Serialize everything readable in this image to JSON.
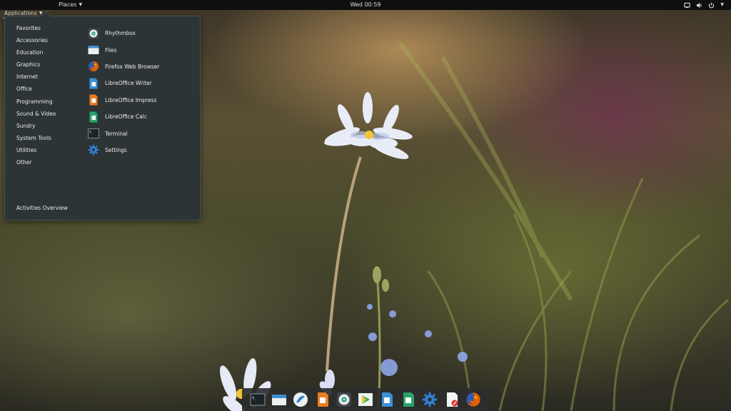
{
  "topbar": {
    "applications_label": "Applications",
    "places_label": "Places",
    "clock": "Wed 00:59",
    "tray_icons": [
      "screen-icon",
      "volume-icon",
      "power-icon"
    ]
  },
  "menu": {
    "categories": [
      "Favorites",
      "Accessories",
      "Education",
      "Graphics",
      "Internet",
      "Office",
      "Programming",
      "Sound & Video",
      "Sundry",
      "System Tools",
      "Utilities",
      "Other"
    ],
    "activities_overview": "Activities Overview",
    "apps": [
      {
        "label": "Rhythmbox",
        "icon": "rhythmbox-icon"
      },
      {
        "label": "Files",
        "icon": "files-icon"
      },
      {
        "label": "Firefox Web Browser",
        "icon": "firefox-icon"
      },
      {
        "label": "LibreOffice Writer",
        "icon": "writer-icon"
      },
      {
        "label": "LibreOffice Impress",
        "icon": "impress-icon"
      },
      {
        "label": "LibreOffice Calc",
        "icon": "calc-icon"
      },
      {
        "label": "Terminal",
        "icon": "terminal-icon"
      },
      {
        "label": "Settings",
        "icon": "settings-icon"
      }
    ]
  },
  "dock": {
    "items": [
      "terminal-icon",
      "files-icon",
      "shotwell-icon",
      "impress-icon",
      "rhythmbox-icon",
      "software-icon",
      "writer-icon",
      "calc-icon",
      "settings-icon",
      "text-editor-icon",
      "firefox-icon"
    ]
  },
  "colors": {
    "accent": "#4a90d9",
    "menu_bg": "#2d3436",
    "topbar_bg": "#0f0f0f"
  }
}
